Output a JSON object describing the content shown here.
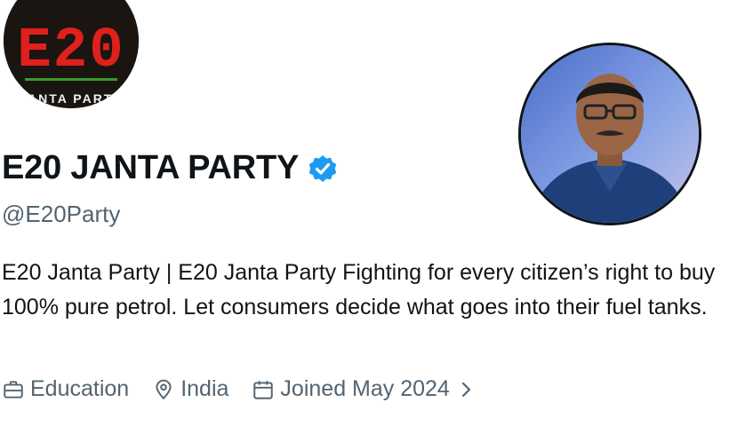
{
  "profile": {
    "avatar_logo_text": "E20",
    "avatar_logo_subtext": "JANTA PARTY",
    "name": "E20 JANTA PARTY",
    "verified": true,
    "handle": "@E20Party",
    "bio": "E20 Janta Party | E20 Janta Party Fighting for every citizen’s right to buy 100% pure petrol. Let consumers decide what goes into their fuel tanks.",
    "meta": {
      "category": "Education",
      "location": "India",
      "joined": "Joined May 2024"
    }
  },
  "icons": {
    "category": "briefcase-icon",
    "location": "location-pin-icon",
    "joined": "calendar-icon",
    "expand": "chevron-right-icon",
    "verified": "verified-badge-icon"
  },
  "colors": {
    "text_primary": "#0f1419",
    "text_secondary": "#536471",
    "verified_blue": "#1d9bf0",
    "logo_red": "#e0201c",
    "logo_green": "#3a9a2a"
  }
}
